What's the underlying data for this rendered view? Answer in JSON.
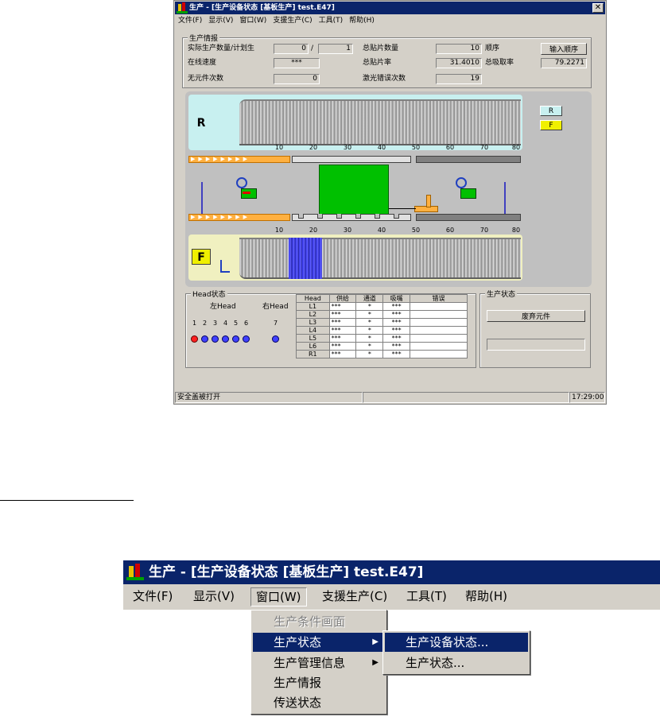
{
  "window": {
    "title": "生产 - [生产设备状态 [基板生产] test.E47]",
    "close_glyph": "✕",
    "menu": [
      "文件(F)",
      "显示(V)",
      "窗口(W)",
      "支援生产(C)",
      "工具(T)",
      "帮助(H)"
    ]
  },
  "production_info": {
    "group_title": "生产情报",
    "actual_plan_label": "实际生产数量/计划生",
    "actual_value": "0",
    "separator": "/",
    "plan_value": "1",
    "total_mount_label": "总贴片数量",
    "total_mount_value": "10",
    "order_label": "顺序",
    "order_button": "输入顺序",
    "line_speed_label": "在线速度",
    "line_speed_value": "***",
    "mount_rate_label": "总贴片率",
    "mount_rate_value": "31.4010",
    "pickup_rate_label": "总吸取率",
    "pickup_rate_value": "79.2271",
    "no_part_label": "无元件次数",
    "no_part_value": "0",
    "laser_error_label": "激光错误次数",
    "laser_error_value": "19"
  },
  "machine": {
    "rear_badge": "R",
    "front_badge": "F",
    "legend_r": "R",
    "legend_f": "F",
    "ticks": [
      "10",
      "20",
      "30",
      "40",
      "50",
      "60",
      "70",
      "80"
    ],
    "conveyor_arrows": "▶▶▶▶▶▶▶▶",
    "colors": {
      "rear_zone": "#c8f0f0",
      "front_zone": "#f0f0c0",
      "board": "#00c000",
      "active_feeder": "#4040ff",
      "conveyor": "#ffb040"
    }
  },
  "head_status": {
    "group_title": "Head状态",
    "left_label": "左Head",
    "right_label": "右Head",
    "numbers": [
      "1",
      "2",
      "3",
      "4",
      "5",
      "6",
      "7"
    ],
    "columns": [
      "Head",
      "供给",
      "通道",
      "吸嘴",
      "错误"
    ],
    "rows": [
      [
        "L1",
        "***",
        "*",
        "***",
        ""
      ],
      [
        "L2",
        "***",
        "*",
        "***",
        ""
      ],
      [
        "L3",
        "***",
        "*",
        "***",
        ""
      ],
      [
        "L4",
        "***",
        "*",
        "***",
        ""
      ],
      [
        "L5",
        "***",
        "*",
        "***",
        ""
      ],
      [
        "L6",
        "***",
        "*",
        "***",
        ""
      ],
      [
        "R1",
        "***",
        "*",
        "***",
        ""
      ]
    ]
  },
  "production_state": {
    "group_title": "生产状态",
    "discard_button": "废弃元件",
    "message": ""
  },
  "statusbar": {
    "message": "安全盖被打开",
    "time": "17:29:00"
  },
  "zoom": {
    "title": "生产 - [生产设备状态 [基板生产] test.E47]",
    "menu": [
      "文件(F)",
      "显示(V)",
      "窗口(W)",
      "支援生产(C)",
      "工具(T)",
      "帮助(H)"
    ],
    "window_menu_items": [
      "生产条件画面",
      "生产状态",
      "生产管理信息",
      "生产情报",
      "传送状态"
    ],
    "submenu_items": [
      "生产设备状态...",
      "生产状态..."
    ],
    "arrow_glyph": "▶"
  }
}
